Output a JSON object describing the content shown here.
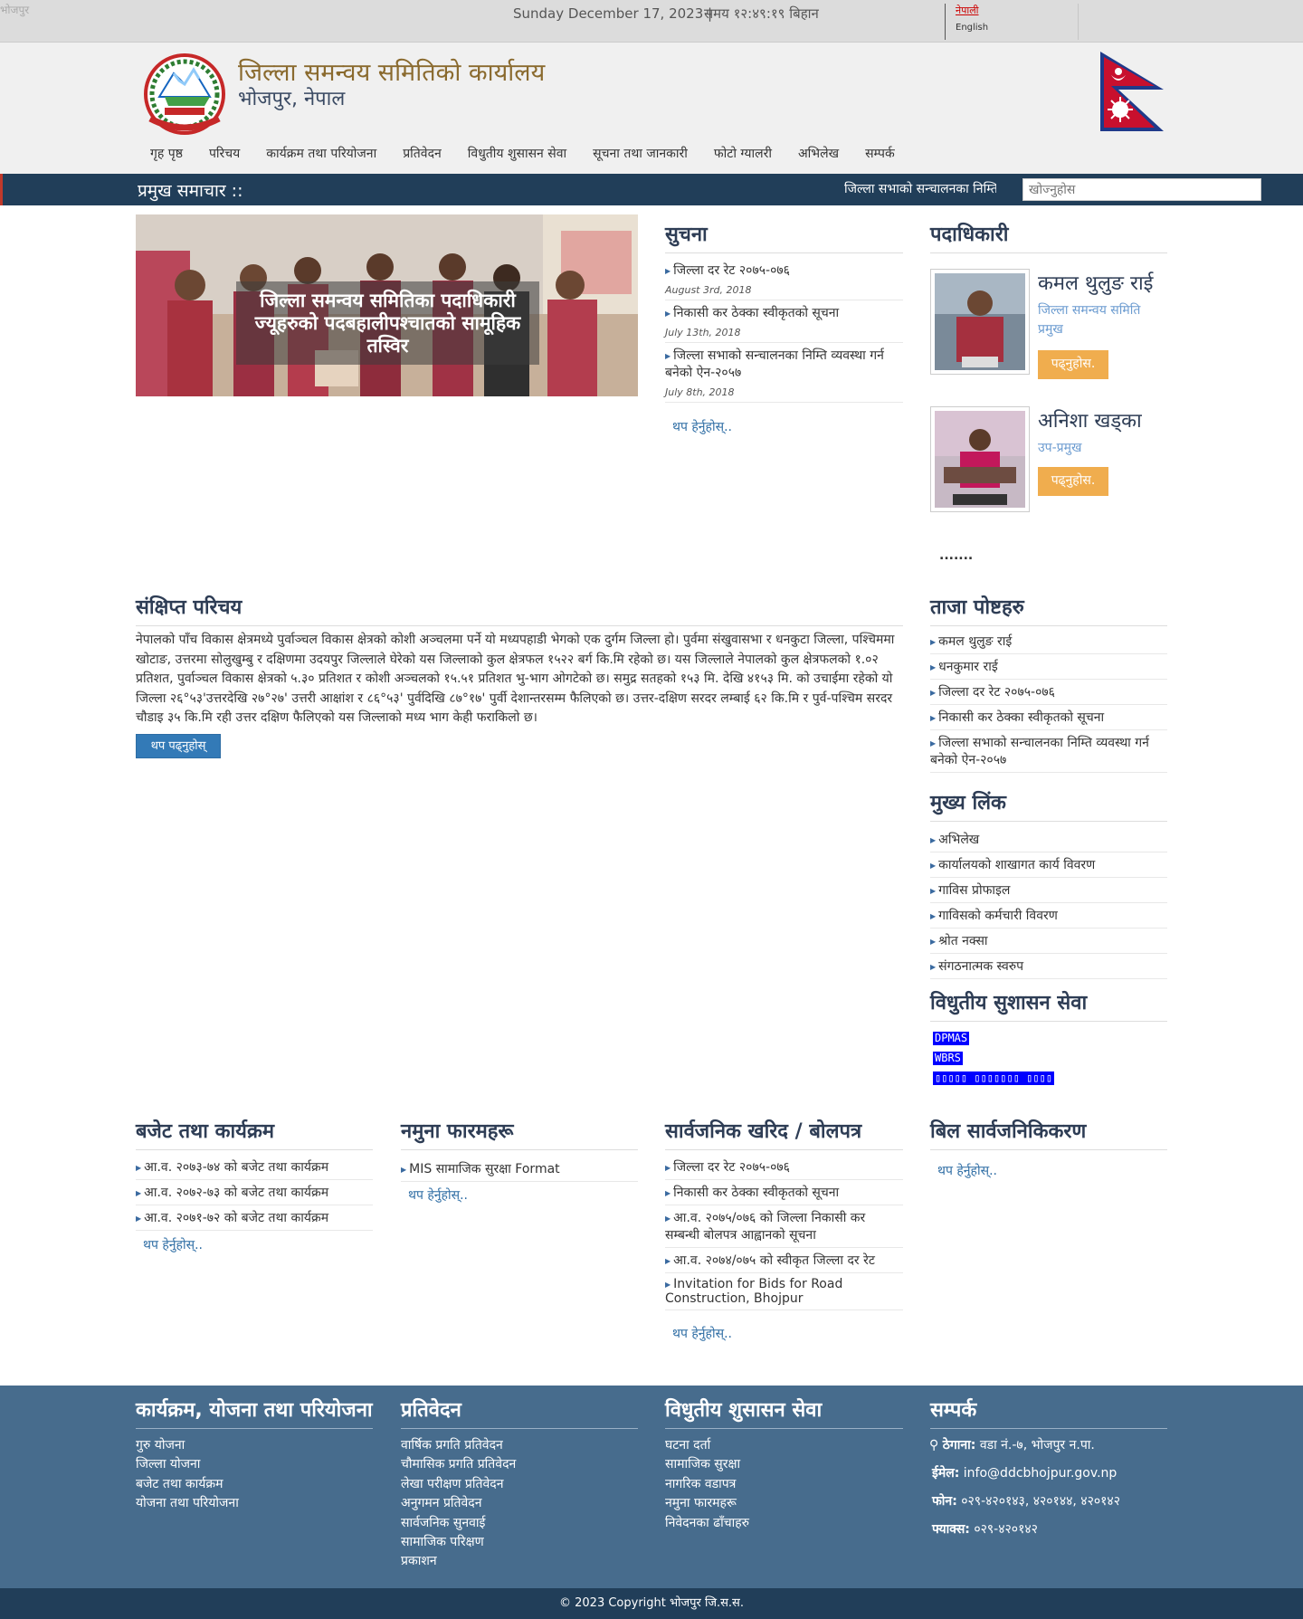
{
  "topbar": {
    "broken_img_alt": "भोजपुर",
    "date": "Sunday December 17, 2023 |",
    "time": "समय १२:४९:१९ बिहान",
    "lang_ne": "नेपाली",
    "lang_en": "English"
  },
  "header": {
    "title": "जिल्ला समन्वय समितिको कार्यालय",
    "subtitle": "भोजपुर, नेपाल"
  },
  "nav": [
    "गृह पृष्ठ",
    "परिचय",
    "कार्यक्रम तथा परियोजना",
    "प्रतिवेदन",
    "विधुतीय शुसासन सेवा",
    "सूचना तथा जानकारी",
    "फोटो ग्यालरी",
    "अभिलेख",
    "सम्पर्क"
  ],
  "ticker": {
    "label": "प्रमुख समाचार ::",
    "message": "जिल्ला सभाको सन्चालनका निम्ति व्यवस्था गर्न बनेको ऐन-२०५७",
    "search_placeholder": "खोज्नुहोस"
  },
  "slider": {
    "caption": "जिल्ला समन्वय समितिका पदाधिकारी ज्यूहरुको पदबहालीपश्चातको सामूहिक तस्विर"
  },
  "notices": {
    "title": "सुचना",
    "items": [
      {
        "text": "जिल्ला दर रेट २०७५-०७६",
        "date": "August 3rd, 2018"
      },
      {
        "text": "निकासी कर ठेक्का स्वीकृतको सूचना",
        "date": "July 13th, 2018"
      },
      {
        "text": "जिल्ला सभाको सन्चालनका निम्ति व्यवस्था गर्न बनेको ऐन-२०५७",
        "date": "July 8th, 2018"
      }
    ],
    "more": "थप हेर्नुहोस्.."
  },
  "officials": {
    "title": "पदाधिकारी",
    "items": [
      {
        "name": "कमल थुलुङ राई",
        "role": "जिल्ला समन्वय समिति प्रमुख",
        "button": "पढ्नुहोस."
      },
      {
        "name": "अनिशा खड्का",
        "role": "उप-प्रमुख",
        "button": "पढ्नुहोस."
      }
    ],
    "more": "......."
  },
  "intro": {
    "title": "संक्षिप्त परिचय",
    "text": "नेपालको पाँच विकास क्षेत्रमध्ये पुर्वाञ्चल विकास क्षेत्रको कोशी अञ्चलमा पर्ने यो मध्यपहाडी भेगको एक दुर्गम जिल्ला हो। पुर्वमा संखुवासभा र धनकुटा जिल्ला, पश्चिममा खोटाङ, उत्तरमा सोलुखुम्बु र दक्षिणमा उदयपुर जिल्लाले घेरेको यस जिल्लाको कुल क्षेत्रफल १५२२ बर्ग कि.मि रहेको छ। यस जिल्लाले नेपालको कुल क्षेत्रफलको १.०२ प्रतिशत, पुर्वाञ्चल विकास क्षेत्रको ५.३० प्रतिशत र कोशी अञ्चलको १५.५१ प्रतिशत भु-भाग ओगटेको छ। समुद्र सतहको १५३ मि. देखि ४१५३ मि. को उचाईमा रहेको यो जिल्ला २६°५३'उत्तरदेखि २७°२७' उत्तरी आक्षांश र ८६°५३' पुर्वदिखि ८७°१७' पुर्वी देशान्तरसम्म फैलिएको छ। उत्तर-दक्षिण सरदर लम्बाई ६२ कि.मि र पुर्व-पश्चिम सरदर चौडाइ ३५ कि.मि रही उत्तर दक्षिण फैलिएको यस जिल्लाको मध्य भाग केही फराकिलो छ।",
    "button": "थप पढ्नुहोस्"
  },
  "latest_posts": {
    "title": "ताजा पोष्टहरु",
    "items": [
      "कमल थुलुङ राई",
      "धनकुमार राई",
      "जिल्ला दर रेट २०७५-०७६",
      "निकासी कर ठेक्का स्वीकृतको सूचना",
      "जिल्ला सभाको सन्चालनका निम्ति व्यवस्था गर्न बनेको ऐन-२०५७"
    ]
  },
  "main_links": {
    "title": "मुख्य लिंक",
    "items": [
      "अभिलेख",
      "कार्यालयको शाखागत कार्य विवरण",
      "गाविस प्रोफाइल",
      "गाविसको कर्मचारी विवरण",
      "श्रोत नक्सा",
      "संगठनात्मक स्वरुप"
    ]
  },
  "egov": {
    "title": "विधुतीय सुशासन सेवा",
    "items": [
      "DPMAS",
      "WBRS",
      "▯▯▯▯▯ ▯▯▯▯▯▯▯ ▯▯▯▯"
    ]
  },
  "budget": {
    "title": "बजेट तथा कार्यक्रम",
    "items": [
      "आ.व. २०७३-७४ को बजेट तथा कार्यक्रम",
      "आ.व. २०७२-७३ को बजेट तथा कार्यक्रम",
      "आ.व. २०७१-७२ को बजेट तथा कार्यक्रम"
    ],
    "more": "थप हेर्नुहोस्.."
  },
  "forms": {
    "title": "नमुना फारमहरू",
    "items": [
      "MIS सामाजिक सुरक्षा Format"
    ],
    "more": "थप हेर्नुहोस्.."
  },
  "procurement": {
    "title": "सार्वजनिक खरिद / बोलपत्र",
    "items": [
      "जिल्ला दर रेट २०७५-०७६",
      "निकासी कर ठेक्का स्वीकृतको सूचना",
      "आ.व. २०७५/०७६ को जिल्ला निकासी कर सम्बन्धी बोलपत्र आह्वानको सूचना",
      "आ.व. २०७४/०७५ को स्वीकृत जिल्ला दर रेट",
      "Invitation for Bids for Road Construction, Bhojpur"
    ],
    "more": "थप हेर्नुहोस्.."
  },
  "bills": {
    "title": "बिल सार्वजनिकिकरण",
    "more": "थप हेर्नुहोस्.."
  },
  "footer": {
    "col1": {
      "title": "कार्यक्रम, योजना तथा परियोजना",
      "items": [
        "गुरु योजना",
        "जिल्ला योजना",
        "बजेट तथा कार्यक्रम",
        "योजना तथा परियोजना"
      ]
    },
    "col2": {
      "title": "प्रतिवेदन",
      "items": [
        "वार्षिक प्रगति प्रतिवेदन",
        "चौमासिक प्रगति प्रतिवेदन",
        "लेखा परीक्षण प्रतिवेदन",
        "अनुगमन प्रतिवेदन",
        "सार्वजनिक सुनवाई",
        "सामाजिक परिक्षण",
        "प्रकाशन"
      ]
    },
    "col3": {
      "title": "विधुतीय शुसासन सेवा",
      "items": [
        "घटना दर्ता",
        "सामाजिक सुरक्षा",
        "नागरिक वडापत्र",
        "नमुना फारमहरू",
        "निवेदनका ढाँचाहरु"
      ]
    },
    "contact": {
      "title": "सम्पर्क",
      "address_label": "ठेगाना:",
      "address": "वडा नं.-७, भोजपुर न.पा.",
      "email_label": "ईमेल:",
      "email": "info@ddcbhojpur.gov.np",
      "phone_label": "फोन:",
      "phone": "०२९-४२०१४३, ४२०१४४, ४२०१४२",
      "fax_label": "फ्याक्स:",
      "fax": "०२९-४२०१४२"
    },
    "copyright": "© 2023 Copyright भोजपुर जि.स.स."
  },
  "colors": {
    "navy": "#213e59",
    "footer": "#476c8d",
    "accent_orange": "#f0ad4e",
    "link_blue": "#2e6da4"
  }
}
